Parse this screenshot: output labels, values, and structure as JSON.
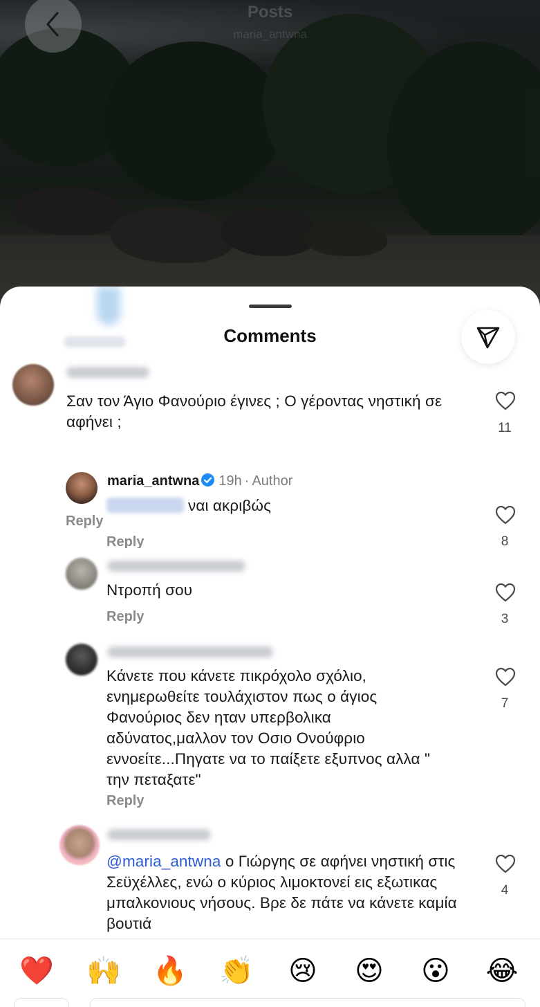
{
  "header": {
    "title": "Posts",
    "subtitle": "maria_antwna"
  },
  "sheet": {
    "title": "Comments"
  },
  "comments": [
    {
      "text": "Σαν τον Άγιο Φανούριο έγινες ; Ο γέροντας νηστική σε αφήνει ;",
      "reply_label": "Reply",
      "likes": "11"
    },
    {
      "username": "maria_antwna",
      "time": "19h",
      "author_badge": "Author",
      "text": "ναι ακριβώς",
      "reply_label": "Reply",
      "likes": "8"
    },
    {
      "text": "Ντροπή σου",
      "reply_label": "Reply",
      "likes": "3"
    },
    {
      "text": "Κάνετε που κάνετε πικρόχολο σχόλιο, ενημερωθείτε τουλάχιστον πως ο άγιος Φανούριος δεν ηταν υπερβολικα αδύνατος,μαλλον τον Οσιο Ονούφριο εννοείτε...Πηγατε να το παίξετε εξυπνος αλλα \" την πεταξατε\"",
      "reply_label": "Reply",
      "likes": "7"
    },
    {
      "mention": "@maria_antwna",
      "text": " ο Γιώργης σε αφήνει νηστική στις Σεϋχέλλες, ενώ ο κύριος λιμοκτονεί εις εξωτικας μπαλκονιους νήσους. Βρε δε πάτε να κάνετε καμία βουτιά",
      "likes": "4"
    }
  ],
  "reactions": [
    "❤️",
    "🙌",
    "🔥",
    "👏",
    "😢",
    "😍",
    "😮",
    "😂"
  ],
  "colors": {
    "mention": "#2d5bd1",
    "verified": "#1d8cf8",
    "heart_red": "#ed1c24"
  }
}
